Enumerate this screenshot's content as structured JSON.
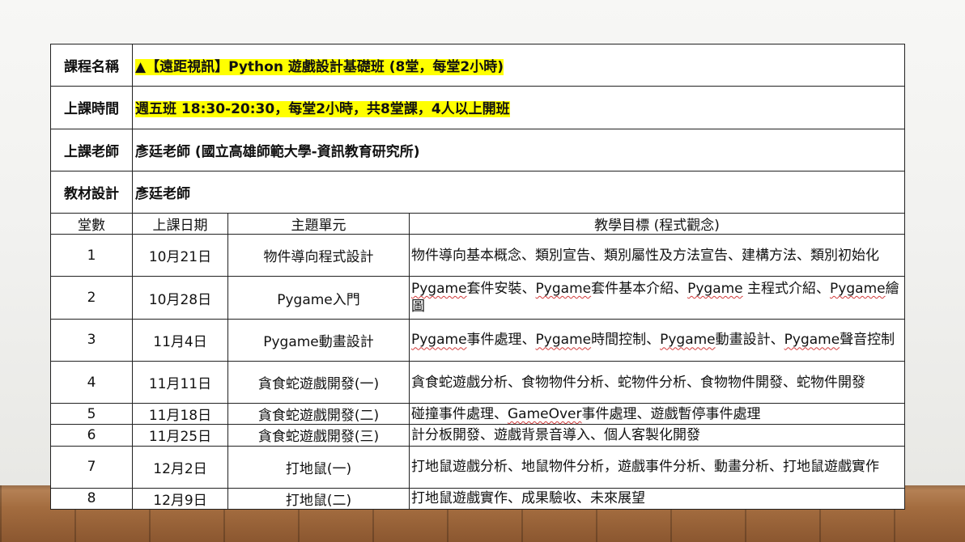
{
  "course_info": [
    {
      "label": "課程名稱",
      "value": "▲【遠距視訊】Python 遊戲設計基礎班 (8堂，每堂2小時)",
      "highlight": true
    },
    {
      "label": "上課時間",
      "value": "週五班 18:30-20:30，每堂2小時，共8堂課，4人以上開班",
      "highlight": true
    },
    {
      "label": "上課老師",
      "value": "彥廷老師 (國立高雄師範大學-資訊教育研究所)",
      "highlight": false
    },
    {
      "label": "教材設計",
      "value": "彥廷老師",
      "highlight": false
    }
  ],
  "schedule_headers": [
    "堂數",
    "上課日期",
    "主題單元",
    "教學目標 (程式觀念)"
  ],
  "schedule": [
    {
      "no": "1",
      "date": "10月21日",
      "topic": "物件導向程式設計",
      "goal": "物件導向基本概念、類別宣告、類別屬性及方法宣告、建構方法、類別初始化"
    },
    {
      "no": "2",
      "date": "10月28日",
      "topic": "Pygame入門",
      "goal": "Pygame套件安裝、Pygame套件基本介紹、Pygame 主程式介紹、Pygame繪圖"
    },
    {
      "no": "3",
      "date": "11月4日",
      "topic": "Pygame動畫設計",
      "goal": "Pygame事件處理、Pygame時間控制、Pygame動畫設計、Pygame聲音控制"
    },
    {
      "no": "4",
      "date": "11月11日",
      "topic": "貪食蛇遊戲開發(一)",
      "goal": "貪食蛇遊戲分析、食物物件分析、蛇物件分析、食物物件開發、蛇物件開發"
    },
    {
      "no": "5",
      "date": "11月18日",
      "topic": "貪食蛇遊戲開發(二)",
      "goal": "碰撞事件處理、GameOver事件處理、遊戲暫停事件處理"
    },
    {
      "no": "6",
      "date": "11月25日",
      "topic": "貪食蛇遊戲開發(三)",
      "goal": "計分板開發、遊戲背景音導入、個人客製化開發"
    },
    {
      "no": "7",
      "date": "12月2日",
      "topic": "打地鼠(一)",
      "goal": "打地鼠遊戲分析、地鼠物件分析，遊戲事件分析、動畫分析、打地鼠遊戲實作"
    },
    {
      "no": "8",
      "date": "12月9日",
      "topic": "打地鼠(二)",
      "goal": "打地鼠遊戲實作、成果驗收、未來展望"
    }
  ]
}
